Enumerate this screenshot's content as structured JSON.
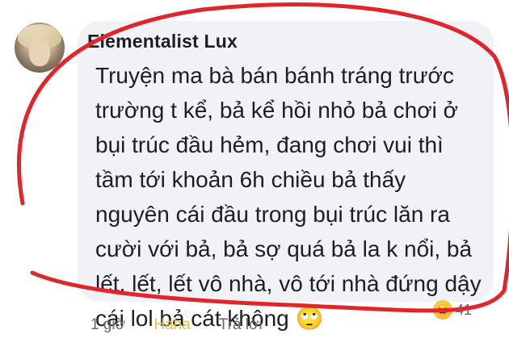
{
  "comment": {
    "author": "Elementalist Lux",
    "text": "Truyện ma bà bán bánh tráng trước trường t kể, bả kể hồi nhỏ bả chơi ở bụi trúc đầu hẻm, đang chơi vui thì tầm tới khoản 6h chiều bả thấy nguyên cái đầu trong bụi trúc lăn ra cười với bả, bả sợ quá bả la k nổi, bả lết, lết, lết vô nhà, vô tới nhà đứng dậy cái lol bả cát không",
    "emoji": "🙄",
    "time": "1 giờ",
    "like_label": "Haha",
    "reply_label": "Trả lời",
    "reaction_count": "41",
    "reaction_icon": "haha-reaction-icon"
  },
  "annotation": {
    "color": "#e0262b"
  }
}
